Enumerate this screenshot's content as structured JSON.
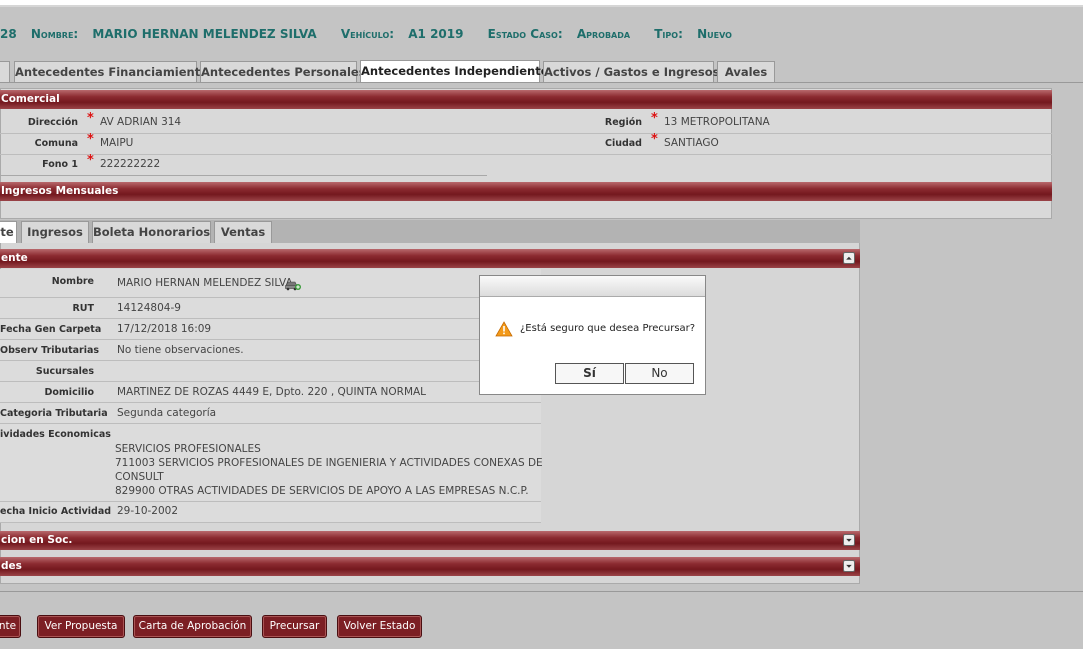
{
  "header": {
    "case_no": "28",
    "nombre_label": "Nombre:",
    "nombre_value": "MARIO HERNAN MELENDEZ SILVA",
    "vehiculo_label": "Vehículo:",
    "vehiculo_value": "A1 2019",
    "estado_label": "Estado Caso:",
    "estado_value": "Aprobada",
    "tipo_label": "Tipo:",
    "tipo_value": "Nuevo"
  },
  "tabs": [
    {
      "label": "Antecedentes Financiamiento"
    },
    {
      "label": "Antecedentes Personales"
    },
    {
      "label": "Antecedentes Independiente"
    },
    {
      "label": "Activos / Gastos e Ingresos"
    },
    {
      "label": "Avales"
    }
  ],
  "comercial": {
    "title": "Comercial",
    "direccion_label": "Dirección",
    "direccion_value": "AV ADRIAN 314",
    "region_label": "Región",
    "region_value": "13 METROPOLITANA",
    "comuna_label": "Comuna",
    "comuna_value": "MAIPU",
    "ciudad_label": "Ciudad",
    "ciudad_value": "SANTIAGO",
    "fono_label": "Fono 1",
    "fono_value": "222222222"
  },
  "ingresos_title": "Ingresos Mensuales",
  "subtabs": [
    {
      "label": "te"
    },
    {
      "label": "Ingresos"
    },
    {
      "label": "Boleta Honorarios"
    },
    {
      "label": "Ventas"
    }
  ],
  "cliente": {
    "title": "ente",
    "nombre_label": "Nombre",
    "nombre_value": "MARIO HERNAN MELENDEZ SILVA",
    "rut_label": "RUT",
    "rut_value": "14124804-9",
    "fecha_label": "Fecha Gen Carpeta",
    "fecha_value": "17/12/2018 16:09",
    "observ_label": "Observ Tributarias",
    "observ_value": "No tiene observaciones.",
    "sucursales_label": "Sucursales",
    "sucursales_value": "",
    "domicilio_label": "Domicilio",
    "domicilio_value": "MARTINEZ DE ROZAS 4449 E, Dpto. 220 , QUINTA NORMAL",
    "categoria_label": "Categoria Tributaria",
    "categoria_value": "Segunda categoría",
    "actividades_label": "ividades Economicas",
    "actividades_lines": [
      "SERVICIOS PROFESIONALES",
      "711003 SERVICIOS PROFESIONALES DE INGENIERIA Y ACTIVIDADES CONEXAS DE",
      "CONSULT",
      "829900 OTRAS ACTIVIDADES DE SERVICIOS DE APOYO A LAS EMPRESAS N.C.P."
    ],
    "inicio_label": "echa Inicio Actividad",
    "inicio_value": "29-10-2002"
  },
  "sections": {
    "soc_title": "cion en Soc.",
    "des_title": "des"
  },
  "dialog": {
    "message": "¿Está seguro que desea Precursar?",
    "yes": "Sí",
    "no": "No"
  },
  "buttons": [
    {
      "label": "nte"
    },
    {
      "label": "Ver Propuesta"
    },
    {
      "label": "Carta de Aprobación"
    },
    {
      "label": "Precursar"
    },
    {
      "label": "Volver Estado"
    }
  ],
  "colors": {
    "accent": "#7c1f24",
    "header_text": "#1e6e6b",
    "background": "#c4c4c4"
  }
}
